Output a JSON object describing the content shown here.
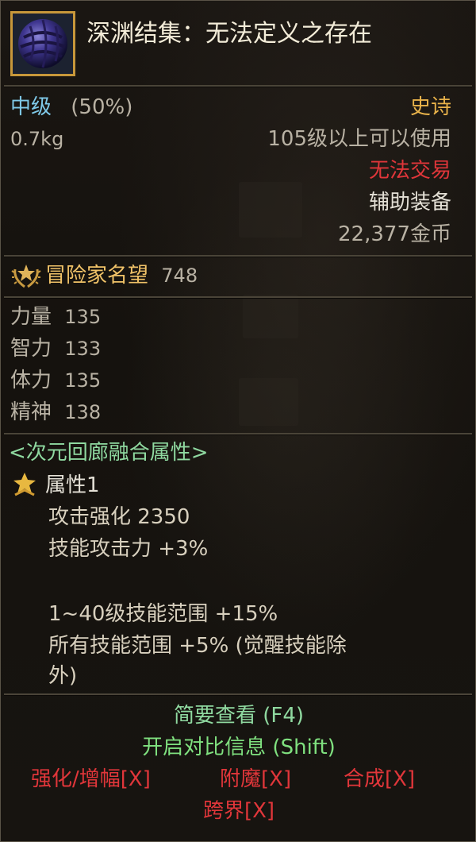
{
  "item": {
    "name": "深渊结集：无法定义之存在",
    "grade": "中级",
    "grade_pct": "(50%)",
    "weight": "0.7kg",
    "rarity": "史诗",
    "level_req": "105级以上可以使用",
    "trade": "无法交易",
    "type": "辅助装备",
    "price": "22,377金币"
  },
  "fame": {
    "label": "冒险家名望",
    "value": "748"
  },
  "stats": [
    {
      "label": "力量",
      "value": "135"
    },
    {
      "label": "智力",
      "value": "133"
    },
    {
      "label": "体力",
      "value": "135"
    },
    {
      "label": "精神",
      "value": "138"
    }
  ],
  "fusion": {
    "header": "<次元回廊融合属性>",
    "attr_title": "属性1",
    "lines": [
      "攻击强化 2350",
      "技能攻击力 +3%",
      "1~40级技能范围 +15%",
      "所有技能范围 +5% (觉醒技能除",
      "外)"
    ]
  },
  "footer": {
    "summary": "简要查看 (F4)",
    "compare": "开启对比信息 (Shift)",
    "actions": [
      "强化/增幅[X]",
      "附魔[X]",
      "合成[X]"
    ],
    "cross": "跨界[X]"
  },
  "colors": {
    "blue": "#7fc9e8",
    "orange": "#e8b24a",
    "red": "#e0363a",
    "gold": "#f0c268",
    "green": "#8fd9a0",
    "border": "#c7973a"
  },
  "icons": [
    "dark-sphere-item-icon",
    "fame-laurel-icon",
    "fusion-attribute-icon"
  ]
}
